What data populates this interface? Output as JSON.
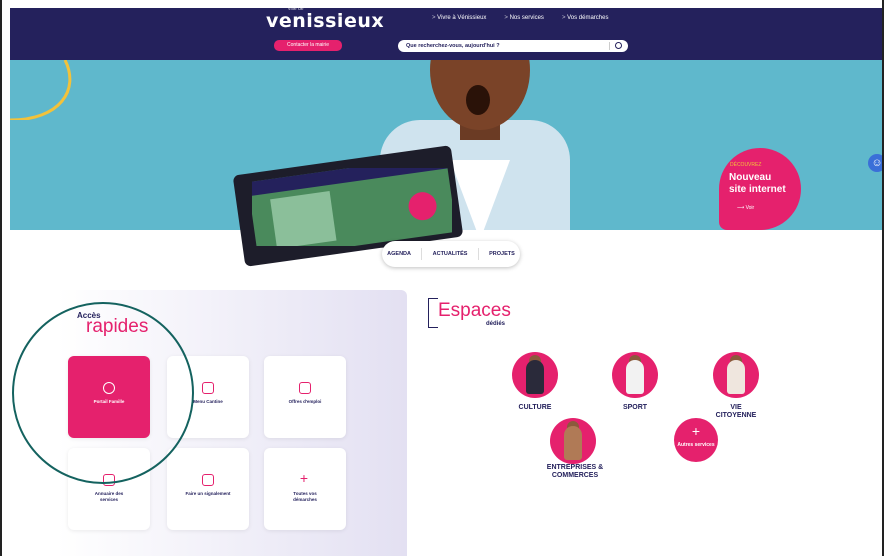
{
  "header": {
    "logo_small": "ville de",
    "logo": "venissieux",
    "contact_button": "Contacter la mairie",
    "nav": [
      "Vivre à Vénissieux",
      "Nos services",
      "Vos démarches"
    ],
    "search_placeholder": "Que recherchez-vous, aujourd'hui ?"
  },
  "hero": {
    "badge_kicker": "DÉCOUVREZ",
    "badge_title_line1": "Nouveau",
    "badge_title_line2": "site internet",
    "badge_link": "Voir"
  },
  "pills": [
    "AGENDA",
    "ACTUALITÉS",
    "PROJETS"
  ],
  "quick_access": {
    "label_small": "Accès",
    "label_big": "rapides",
    "tiles": [
      {
        "label": "Portail Famille",
        "icon": "family-icon"
      },
      {
        "label": "Menu Cantine",
        "icon": "canteen-icon"
      },
      {
        "label": "Offres d'emploi",
        "icon": "job-icon"
      },
      {
        "label": "Annuaire des services",
        "icon": "directory-icon"
      },
      {
        "label": "Faire un signalement",
        "icon": "report-icon"
      },
      {
        "label": "Toutes vos démarches",
        "icon": "plus-icon"
      }
    ]
  },
  "espaces": {
    "title": "Espaces",
    "subtitle": "dédiés",
    "items": [
      {
        "label": "CULTURE"
      },
      {
        "label": "SPORT"
      },
      {
        "label": "VIE CITOYENNE"
      },
      {
        "label": "ENTREPRISES & COMMERCES"
      }
    ],
    "other": "Autres services"
  },
  "colors": {
    "brand_navy": "#24215c",
    "brand_pink": "#e5216d",
    "accent_yellow": "#f3c23a"
  }
}
